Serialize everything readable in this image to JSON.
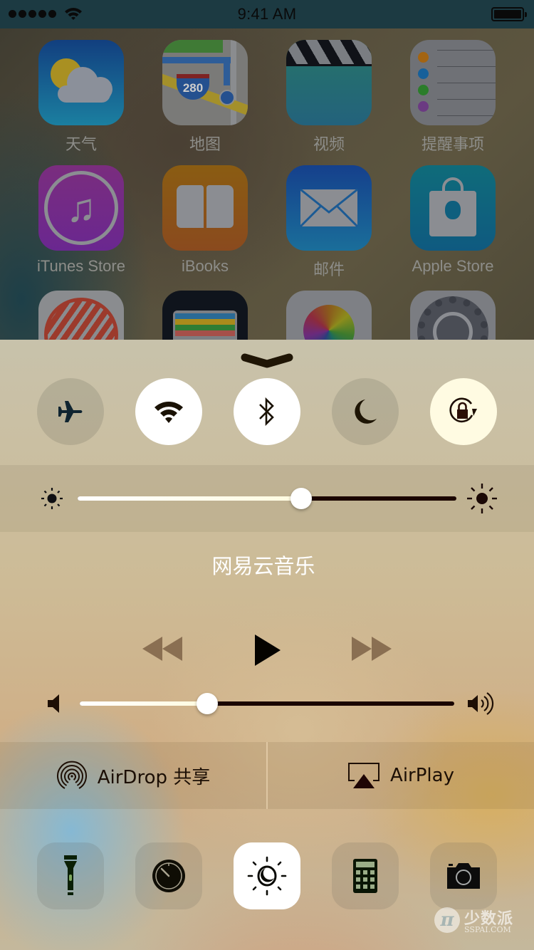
{
  "status_bar": {
    "signal_bars": 5,
    "wifi": "wifi-icon",
    "time": "9:41 AM",
    "battery_percent": 100
  },
  "home_screen": {
    "apps": [
      {
        "label": "天气",
        "icon": "weather-icon"
      },
      {
        "label": "地图",
        "icon": "maps-icon",
        "badge_text": "280"
      },
      {
        "label": "视频",
        "icon": "videos-icon"
      },
      {
        "label": "提醒事项",
        "icon": "reminders-icon"
      },
      {
        "label": "iTunes Store",
        "icon": "itunes-store-icon"
      },
      {
        "label": "iBooks",
        "icon": "ibooks-icon"
      },
      {
        "label": "邮件",
        "icon": "mail-icon"
      },
      {
        "label": "Apple Store",
        "icon": "apple-store-icon"
      },
      {
        "label": "",
        "icon": "workout-app-icon"
      },
      {
        "label": "",
        "icon": "wallet-icon"
      },
      {
        "label": "",
        "icon": "photos-icon"
      },
      {
        "label": "",
        "icon": "settings-icon"
      }
    ]
  },
  "control_center": {
    "grabber": "chevron-down-icon",
    "toggles": [
      {
        "name": "airplane-mode",
        "icon": "airplane-icon",
        "state": "off"
      },
      {
        "name": "wifi",
        "icon": "wifi-icon",
        "state": "on"
      },
      {
        "name": "bluetooth",
        "icon": "bluetooth-icon",
        "state": "on"
      },
      {
        "name": "do-not-disturb",
        "icon": "moon-icon",
        "state": "off"
      },
      {
        "name": "rotation-lock",
        "icon": "rotation-lock-icon",
        "state": "on"
      }
    ],
    "brightness": {
      "value_percent": 59,
      "min_icon": "sun-small-icon",
      "max_icon": "sun-large-icon"
    },
    "now_playing": {
      "app_title": "网易云音乐",
      "rewind_icon": "rewind-icon",
      "play_icon": "play-icon",
      "forward_icon": "fast-forward-icon"
    },
    "volume": {
      "value_percent": 34,
      "min_icon": "speaker-icon",
      "max_icon": "speaker-loud-icon"
    },
    "airdrop_label": "AirDrop 共享",
    "airplay_label": "AirPlay",
    "tools": [
      {
        "name": "flashlight",
        "icon": "flashlight-icon",
        "state": "off"
      },
      {
        "name": "timer",
        "icon": "timer-icon",
        "state": "off"
      },
      {
        "name": "night-shift",
        "icon": "night-shift-icon",
        "state": "on"
      },
      {
        "name": "calculator",
        "icon": "calculator-icon",
        "state": "off"
      },
      {
        "name": "camera",
        "icon": "camera-icon",
        "state": "off"
      }
    ]
  },
  "watermark": {
    "logo": "π",
    "cn": "少数派",
    "en": "SSPAI.COM"
  }
}
